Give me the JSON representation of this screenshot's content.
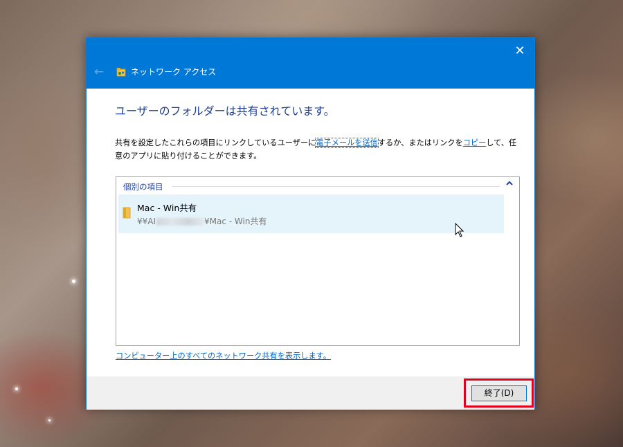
{
  "window": {
    "title": "ネットワーク アクセス",
    "close_glyph": "✕",
    "back_glyph": "←"
  },
  "dialog": {
    "heading": "ユーザーのフォルダーは共有されています。",
    "para_text_1": "共有を設定したこれらの項目にリンクしているユーザーに",
    "email_link": "電子メールを送信",
    "para_text_2": "するか、またはリンクを",
    "copy_link": "コピー",
    "para_text_3": "して、任意のアプリに貼り付けることができます。",
    "group_header": "個別の項目",
    "collapse_glyph": "⌃",
    "items": [
      {
        "name": "Mac - Win共有",
        "path_prefix": "¥¥AI",
        "path_suffix": "¥Mac - Win共有"
      }
    ],
    "show_all_link": "コンピューター上のすべてのネットワーク共有を表示します。"
  },
  "footer": {
    "close_button_label": "終了(D)"
  },
  "colors": {
    "titlebar": "#0078d7",
    "heading": "#1e3f94",
    "link": "#0066cc",
    "selection": "#e5f3fb",
    "highlight_box": "#e0001b"
  },
  "icons": {
    "app": "network-share-icon",
    "folder": "folder-icon",
    "back": "back-arrow-icon",
    "close": "close-icon",
    "collapse": "chevron-up-icon",
    "cursor": "mouse-pointer-icon"
  }
}
